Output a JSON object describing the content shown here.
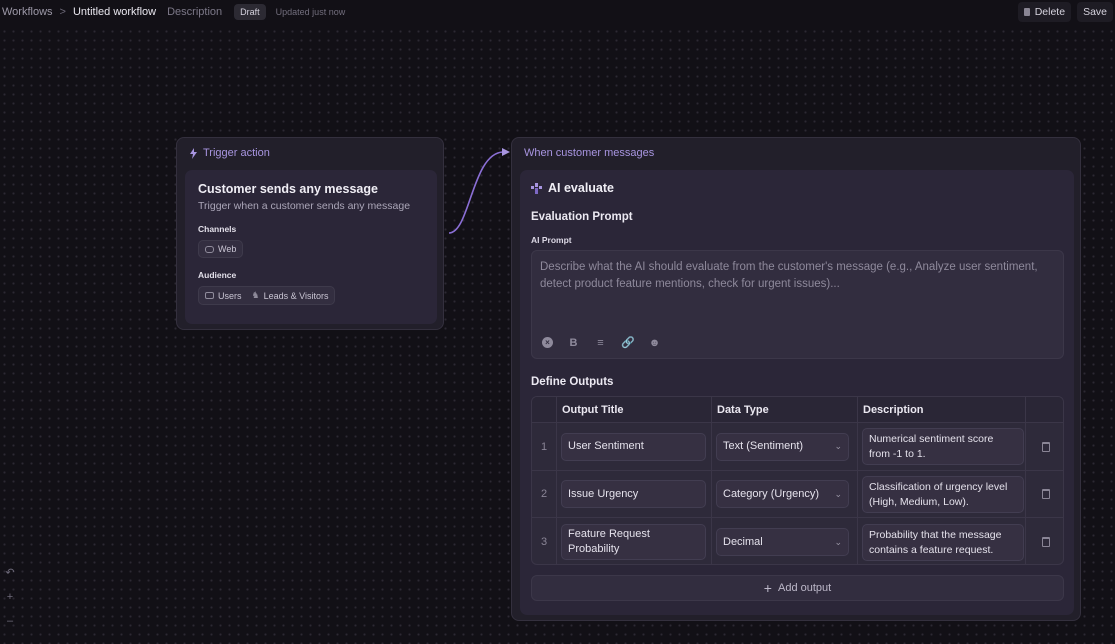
{
  "header": {
    "breadcrumb_root": "Workflows",
    "breadcrumb_separator": ">",
    "workflow_name": "Untitled workflow",
    "description_placeholder": "Description",
    "status_badge": "Draft",
    "updated_text": "Updated just now",
    "delete_label": "Delete",
    "save_label": "Save"
  },
  "trigger_card": {
    "header": "Trigger action",
    "title": "Customer sends any message",
    "subtitle": "Trigger when a customer sends any message",
    "channels_label": "Channels",
    "channels": [
      "Web"
    ],
    "audience_label": "Audience",
    "audience": [
      "Users",
      "Leads & Visitors"
    ]
  },
  "ai_card": {
    "header": "When customer messages",
    "title": "AI evaluate",
    "evaluation_prompt_title": "Evaluation Prompt",
    "ai_prompt_label": "AI Prompt",
    "prompt_placeholder": "Describe what the AI should evaluate from the customer's message (e.g., Analyze user sentiment, detect product feature mentions, check for urgent issues)...",
    "define_outputs_title": "Define Outputs",
    "columns": [
      "Output Title",
      "Data Type",
      "Description"
    ],
    "outputs": [
      {
        "index": "1",
        "title": "User Sentiment",
        "type": "Text (Sentiment)",
        "description": "Numerical sentiment score from -1 to 1."
      },
      {
        "index": "2",
        "title": "Issue Urgency",
        "type": "Category (Urgency)",
        "description": "Classification of urgency level (High, Medium, Low)."
      },
      {
        "index": "3",
        "title": "Feature Request Probability",
        "type": "Decimal",
        "description": "Probability that the message contains a feature request."
      }
    ],
    "add_output_label": "Add output"
  },
  "colors": {
    "background": "#121016",
    "card": "#221f2a",
    "accent": "#a895e0",
    "connector": "#8b6fd6"
  }
}
